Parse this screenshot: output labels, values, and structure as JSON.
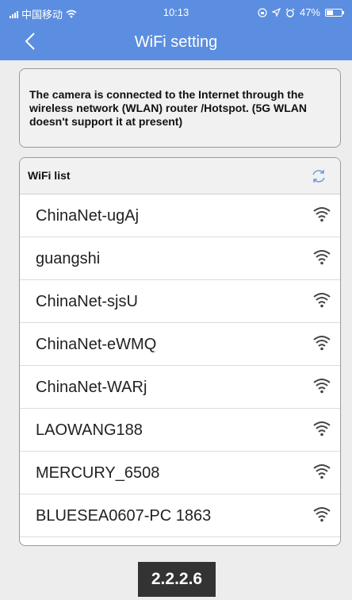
{
  "status_bar": {
    "carrier": "中国移动",
    "time": "10:13",
    "battery": "47%",
    "battery_level": 0.47
  },
  "header": {
    "title": "WiFi setting",
    "back_icon": "chevron-left-icon"
  },
  "info": {
    "text": "The camera is connected to the Internet through the wireless network (WLAN) router /Hotspot. (5G WLAN doesn't support it at present)"
  },
  "wifi_list": {
    "title": "WiFi list",
    "refresh_icon": "refresh-icon",
    "networks": [
      {
        "name": "ChinaNet-ugAj"
      },
      {
        "name": "guangshi"
      },
      {
        "name": "ChinaNet-sjsU"
      },
      {
        "name": "ChinaNet-eWMQ"
      },
      {
        "name": "ChinaNet-WARj"
      },
      {
        "name": "LAOWANG188"
      },
      {
        "name": "MERCURY_6508"
      },
      {
        "name": "BLUESEA0607-PC 1863"
      },
      {
        "name": ""
      }
    ]
  },
  "footer_badge": "2.2.2.6",
  "colors": {
    "accent": "#5b8ee0",
    "background": "#ededed",
    "badge": "#333333"
  }
}
